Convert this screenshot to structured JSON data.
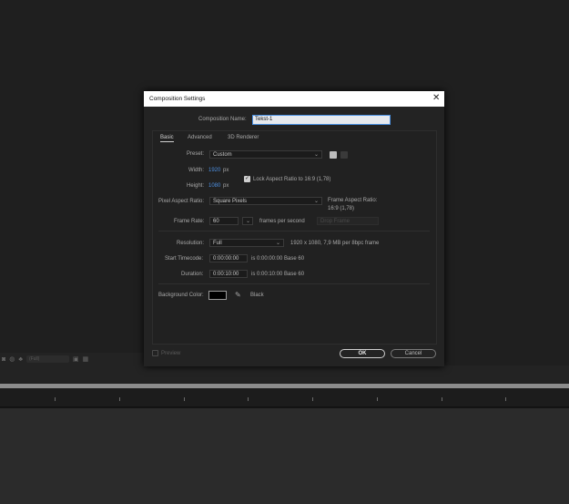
{
  "dialog": {
    "title": "Composition Settings",
    "close_glyph": "✕",
    "comp_name_label": "Composition Name:",
    "comp_name_value": "Tekst-1"
  },
  "tabs": [
    {
      "label": "Basic"
    },
    {
      "label": "Advanced"
    },
    {
      "label": "3D Renderer"
    }
  ],
  "basic": {
    "preset_label": "Preset:",
    "preset_value": "Custom",
    "width_label": "Width:",
    "width_value": "1920",
    "width_unit": "px",
    "height_label": "Height:",
    "height_value": "1080",
    "height_unit": "px",
    "lock_aspect_label": "Lock Aspect Ratio to 16:9 (1,78)",
    "pixel_aspect_label": "Pixel Aspect Ratio:",
    "pixel_aspect_value": "Square Pixels",
    "frame_aspect_label": "Frame Aspect Ratio:",
    "frame_aspect_value": "16:9 (1,78)",
    "frame_rate_label": "Frame Rate:",
    "frame_rate_value": "60",
    "frame_rate_unit": "frames per second",
    "drop_frame_value": "Drop Frame",
    "resolution_label": "Resolution:",
    "resolution_value": "Full",
    "resolution_info": "1920 x 1080, 7,9 MB per 8bpc frame",
    "start_tc_label": "Start Timecode:",
    "start_tc_value": "0:00:00:00",
    "start_tc_info": "is 0:00:00:00  Base 60",
    "duration_label": "Duration:",
    "duration_value": "0:00:10:00",
    "duration_info": "is 0:00:10:00  Base 60",
    "bg_color_label": "Background Color:",
    "bg_color_name": "Black",
    "bg_color_hex": "#000000"
  },
  "footer": {
    "preview_label": "Preview",
    "ok_label": "OK",
    "cancel_label": "Cancel"
  },
  "background_app": {
    "zoom_value": "(Full)"
  },
  "colors": {
    "accent": "#4d8fe0",
    "dialog_bg": "#232323",
    "app_bg": "#1f1f1f"
  }
}
